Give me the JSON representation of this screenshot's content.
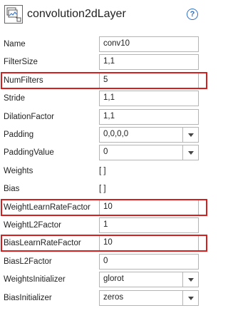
{
  "header": {
    "title": "convolution2dLayer",
    "icon": "layer-graphic-icon",
    "help_glyph": "?"
  },
  "properties": [
    {
      "key": "name",
      "label": "Name",
      "value": "conv10",
      "kind": "text"
    },
    {
      "key": "filter-size",
      "label": "FilterSize",
      "value": "1,1",
      "kind": "text"
    },
    {
      "key": "num-filters",
      "label": "NumFilters",
      "value": "5",
      "kind": "text",
      "highlighted": true
    },
    {
      "key": "stride",
      "label": "Stride",
      "value": "1,1",
      "kind": "text"
    },
    {
      "key": "dilation-factor",
      "label": "DilationFactor",
      "value": "1,1",
      "kind": "text"
    },
    {
      "key": "padding",
      "label": "Padding",
      "value": "0,0,0,0",
      "kind": "combo"
    },
    {
      "key": "padding-value",
      "label": "PaddingValue",
      "value": "0",
      "kind": "combo"
    },
    {
      "key": "weights",
      "label": "Weights",
      "value": "[ ]",
      "kind": "static"
    },
    {
      "key": "bias",
      "label": "Bias",
      "value": "[ ]",
      "kind": "static"
    },
    {
      "key": "weight-learn-rate-factor",
      "label": "WeightLearnRateFactor",
      "value": "10",
      "kind": "text",
      "highlighted": true
    },
    {
      "key": "weight-l2-factor",
      "label": "WeightL2Factor",
      "value": "1",
      "kind": "text"
    },
    {
      "key": "bias-learn-rate-factor",
      "label": "BiasLearnRateFactor",
      "value": "10",
      "kind": "text",
      "highlighted": true
    },
    {
      "key": "bias-l2-factor",
      "label": "BiasL2Factor",
      "value": "0",
      "kind": "text"
    },
    {
      "key": "weights-initializer",
      "label": "WeightsInitializer",
      "value": "glorot",
      "kind": "combo"
    },
    {
      "key": "bias-initializer",
      "label": "BiasInitializer",
      "value": "zeros",
      "kind": "combo"
    }
  ],
  "colors": {
    "highlight_border": "#d62020",
    "help_accent": "#2e6fc4"
  }
}
